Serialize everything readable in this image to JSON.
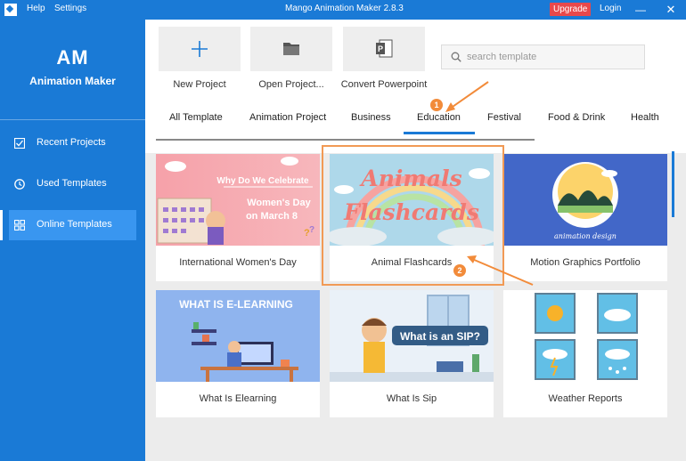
{
  "titlebar": {
    "help": "Help",
    "settings": "Settings",
    "title": "Mango Animation Maker 2.8.3",
    "upgrade": "Upgrade",
    "login": "Login",
    "minimize": "—",
    "close": "✕"
  },
  "sidebar": {
    "logo_mark": "AM",
    "logo_text": "Animation Maker",
    "items": [
      {
        "label": "Recent Projects",
        "icon": "checklist-icon"
      },
      {
        "label": "Used Templates",
        "icon": "clock-icon"
      },
      {
        "label": "Online Templates",
        "icon": "grid-icon",
        "active": true
      }
    ]
  },
  "toolbar": {
    "new_project": "New Project",
    "open_project": "Open Project...",
    "convert_powerpoint": "Convert Powerpoint"
  },
  "search": {
    "placeholder": "search template"
  },
  "tabs": [
    {
      "label": "All Template"
    },
    {
      "label": "Animation Project"
    },
    {
      "label": "Business"
    },
    {
      "label": "Education",
      "active": true
    },
    {
      "label": "Festival"
    },
    {
      "label": "Food & Drink"
    },
    {
      "label": "Health"
    }
  ],
  "templates": [
    {
      "title": "International Women's Day",
      "thumb_line1": "Why Do We Celebrate",
      "thumb_line2": "Women's Day",
      "thumb_line3": "on March 8"
    },
    {
      "title": "Animal Flashcards",
      "thumb_line1": "Animals",
      "thumb_line2": "Flashcards"
    },
    {
      "title": "Motion Graphics Portfolio",
      "thumb_line1": "animation design"
    },
    {
      "title": "What Is Elearning",
      "thumb_line1": "WHAT IS E-LEARNING"
    },
    {
      "title": "What Is Sip",
      "thumb_line1": "What is an SIP?"
    },
    {
      "title": "Weather Reports"
    }
  ],
  "annotations": {
    "step1": "1",
    "step2": "2"
  },
  "colors": {
    "brand_blue": "#1a7ad6",
    "active_item": "#3996f0",
    "upgrade_red": "#e8484b",
    "annotation_orange": "#f28b3a"
  }
}
